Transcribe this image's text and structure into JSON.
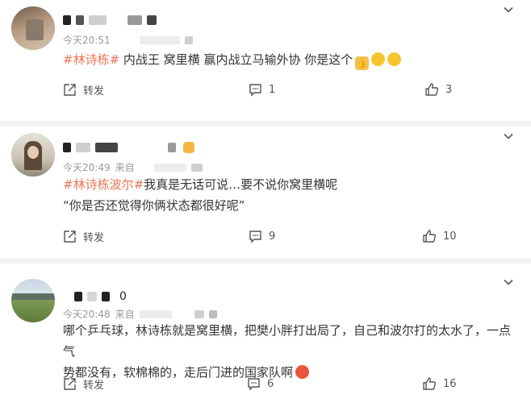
{
  "comments": [
    {
      "username": "・丨丨　丨端",
      "time": "今天20:51",
      "source": "",
      "topic": "#林诗栋#",
      "text": " 内战王 窝里横 赢内战立马输外协 你是这个",
      "line2": "",
      "repost_label": "转发",
      "comment_count": "1",
      "like_count": "3"
    },
    {
      "username": "",
      "time": "今天20:49",
      "source": "来自",
      "topic": "#林诗栋波尔#",
      "text": "我真是无话可说…要不说你窝里横呢",
      "line2": "“你是否还觉得你俩状态都很好呢”",
      "repost_label": "转发",
      "comment_count": "9",
      "like_count": "10"
    },
    {
      "username": "0",
      "time": "今天20:48",
      "source": "来自",
      "topic": "",
      "text": "哪个乒乓球，林诗栋就是窝里横，把樊小胖打出局了，自己和波尔打的太水了，一点气",
      "line2": "势都没有，软棉棉的，走后门进的国家队啊",
      "repost_label": "转发",
      "comment_count": "6",
      "like_count": "16"
    }
  ],
  "icons": {
    "chevron": "chevron-down-icon",
    "repost": "share-icon",
    "comment": "comment-icon",
    "like": "thumbs-up-icon"
  },
  "colors": {
    "topic": "#eb7350",
    "meta": "#999999",
    "separator": "#f2f2f2"
  }
}
